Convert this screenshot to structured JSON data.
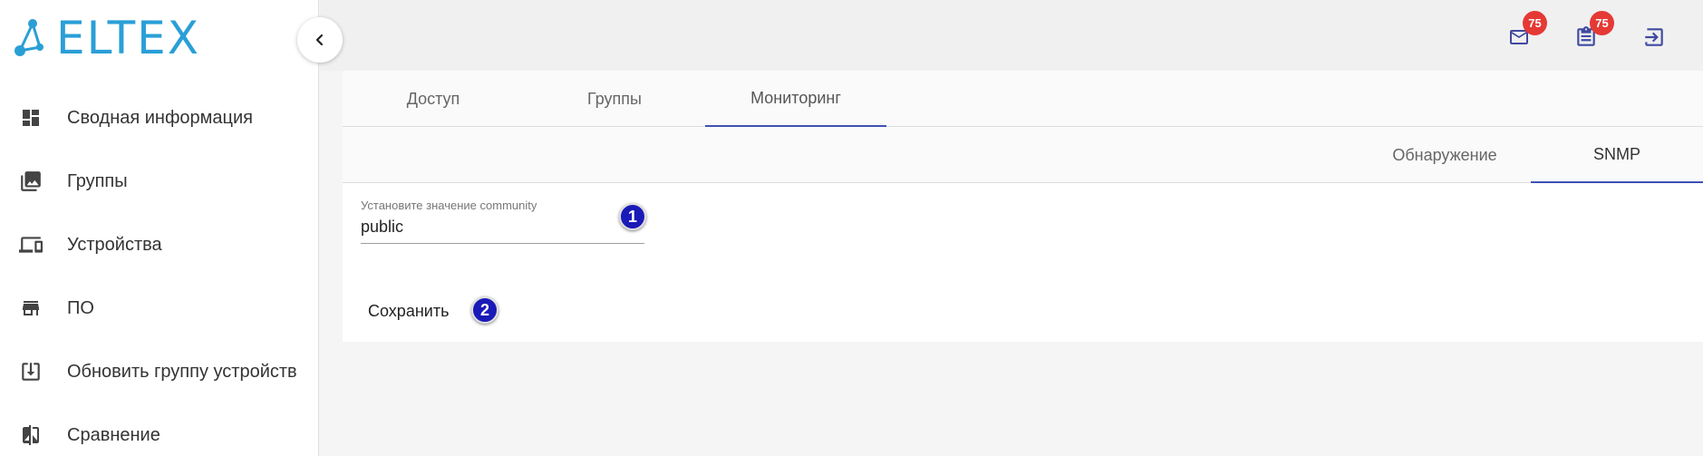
{
  "brand": {
    "logo_text": "ELTEX",
    "color": "#2a9fd6"
  },
  "sidebar": {
    "items": [
      {
        "label": "Сводная информация",
        "icon": "dashboard-icon"
      },
      {
        "label": "Группы",
        "icon": "photo-library-icon"
      },
      {
        "label": "Устройства",
        "icon": "devices-icon"
      },
      {
        "label": "ПО",
        "icon": "store-icon"
      },
      {
        "label": "Обновить группу устройств",
        "icon": "download-box-icon"
      },
      {
        "label": "Сравнение",
        "icon": "compare-icon"
      }
    ]
  },
  "topbar": {
    "mail_badge": "75",
    "tasks_badge": "75"
  },
  "tabs": [
    {
      "label": "Доступ"
    },
    {
      "label": "Группы"
    },
    {
      "label": "Мониторинг",
      "active": true
    }
  ],
  "subtabs": [
    {
      "label": "Обнаружение"
    },
    {
      "label": "SNMP",
      "active": true
    }
  ],
  "form": {
    "community_label": "Установите значение community",
    "community_value": "public",
    "save_label": "Сохранить"
  },
  "markers": [
    "1",
    "2"
  ],
  "colors": {
    "accent": "#3f51b5",
    "badge": "#e53935",
    "marker": "#1a1ab8"
  }
}
